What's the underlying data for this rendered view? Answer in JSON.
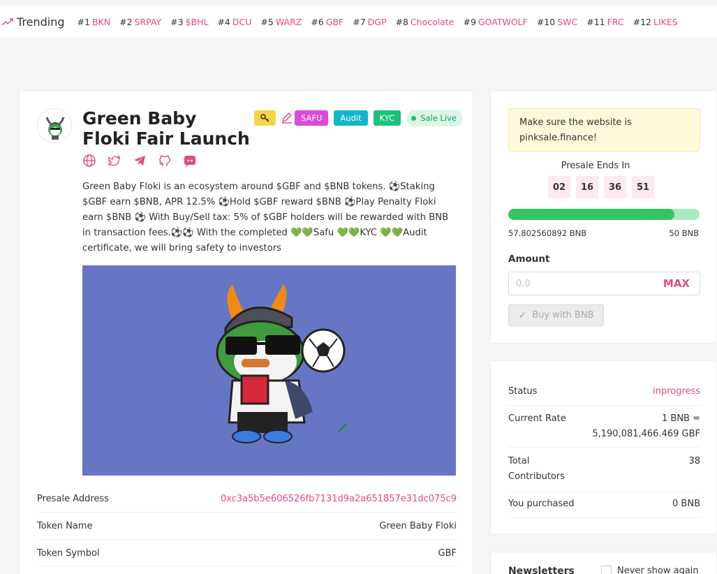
{
  "trending": {
    "title": "Trending",
    "items": [
      {
        "rank": "#1",
        "symbol": "BKN"
      },
      {
        "rank": "#2",
        "symbol": "SRPAY"
      },
      {
        "rank": "#3",
        "symbol": "$BHL"
      },
      {
        "rank": "#4",
        "symbol": "DCU"
      },
      {
        "rank": "#5",
        "symbol": "WARZ"
      },
      {
        "rank": "#6",
        "symbol": "GBF"
      },
      {
        "rank": "#7",
        "symbol": "DGP"
      },
      {
        "rank": "#8",
        "symbol": "Chocolate"
      },
      {
        "rank": "#9",
        "symbol": "GOATWOLF"
      },
      {
        "rank": "#10",
        "symbol": "SWC"
      },
      {
        "rank": "#11",
        "symbol": "FRC"
      },
      {
        "rank": "#12",
        "symbol": "LIKES"
      }
    ]
  },
  "project": {
    "title": "Green Baby Floki Fair Launch",
    "badges": {
      "safu": "SAFU",
      "audit": "Audit",
      "kyc": "KYC",
      "live": "Sale Live"
    },
    "description": "Green Baby Floki is an ecosystem around $GBF and $BNB tokens. ⚽Staking $GBF earn $BNB, APR 12.5% ⚽Hold $GBF reward $BNB ⚽Play Penalty Floki earn $BNB ⚽ With Buy/Sell tax: 5% of $GBF holders will be rewarded with BNB in transaction fees.⚽⚽ With the completed 💚💚Safu 💚💚KYC 💚💚Audit certificate, we will bring safety to investors",
    "details": [
      {
        "label": "Presale Address",
        "value": "0xc3a5b5e606526fb7131d9a2a651857e31dc075c9"
      },
      {
        "label": "Token Name",
        "value": "Green Baby Floki"
      },
      {
        "label": "Token Symbol",
        "value": "GBF"
      }
    ]
  },
  "presale": {
    "warning": "Make sure the website is pinksale.finance!",
    "ends_label": "Presale Ends In",
    "countdown": [
      "02",
      "16",
      "36",
      "51"
    ],
    "raised": "57.802560892 BNB",
    "cap": "50 BNB",
    "progress_percent": 87,
    "amount_label": "Amount",
    "amount_placeholder": "0.0",
    "max_label": "MAX",
    "buy_label": "Buy with BNB"
  },
  "stats": [
    {
      "label": "Status",
      "value": "inprogress"
    },
    {
      "label": "Current Rate",
      "value": "1 BNB = 5,190,081,466.469 GBF"
    },
    {
      "label": "Total Contributors",
      "value": "38"
    },
    {
      "label": "You purchased",
      "value": "0 BNB"
    }
  ],
  "newsletter": {
    "title": "Newsletters",
    "never_show": "Never show again"
  },
  "colors": {
    "accent": "#e5497a",
    "progress": "#36c463",
    "safu": "#d94cd9",
    "audit": "#13b5c9",
    "kyc": "#1ec07a"
  }
}
